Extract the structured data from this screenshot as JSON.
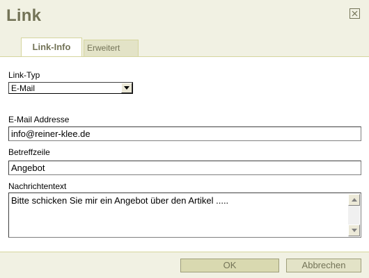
{
  "dialog": {
    "title": "Link",
    "close_icon": "close-icon"
  },
  "tabs": [
    {
      "label": "Link-Info",
      "active": true
    },
    {
      "label": "Erweitert",
      "active": false
    }
  ],
  "form": {
    "link_type_label": "Link-Typ",
    "link_type_value": "E-Mail",
    "email_label": "E-Mail Addresse",
    "email_value": "info@reiner-klee.de",
    "subject_label": "Betreffzeile",
    "subject_value": "Angebot",
    "message_label": "Nachrichtentext",
    "message_value": "Bitte schicken Sie mir ein Angebot über den Artikel ....."
  },
  "buttons": {
    "ok": "OK",
    "cancel": "Abbrechen"
  },
  "colors": {
    "dialog_bg": "#f1f1e3",
    "title": "#737357",
    "tab_border": "#d5d59d"
  }
}
